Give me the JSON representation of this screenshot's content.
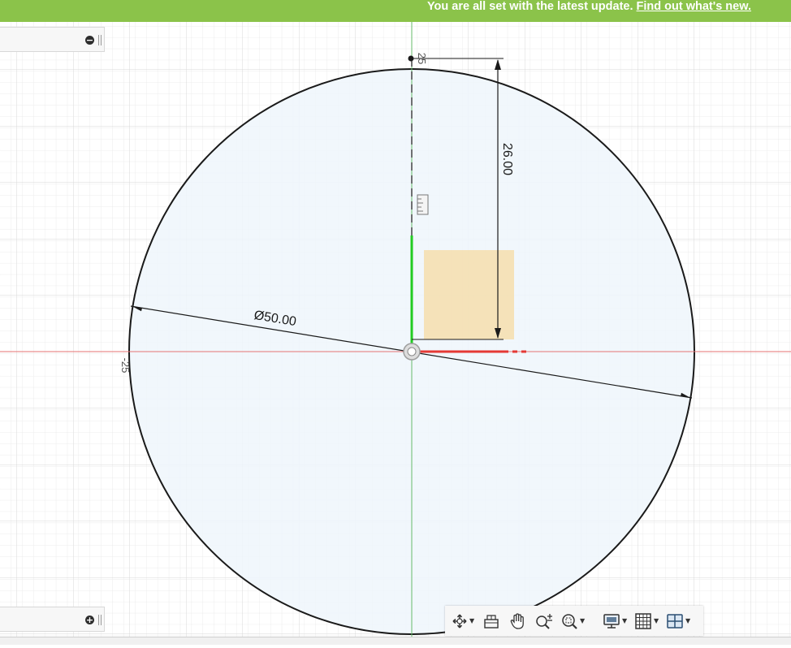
{
  "banner": {
    "message": "You are all set with the latest update.",
    "link": "Find out what's new."
  },
  "sketch": {
    "diameter_label": "Ø50.00",
    "vertical_dim_label": "26.00",
    "axis_top_label": "25",
    "axis_left_label": "-25",
    "profile_fill": "#eef6fc",
    "x_axis_color": "#e57373",
    "y_axis_color": "#66bb6a"
  },
  "panels": {
    "top": {
      "icon": "minus-circle-icon"
    },
    "bottom": {
      "icon": "plus-circle-icon"
    }
  },
  "toolbar": {
    "items": [
      "orbit-icon",
      "look-at-icon",
      "pan-icon",
      "zoom-icon",
      "fit-icon",
      "display-settings-icon",
      "grid-settings-icon",
      "viewports-icon"
    ]
  },
  "colors": {
    "banner": "#8bc34a",
    "accent_red": "#e53935"
  }
}
